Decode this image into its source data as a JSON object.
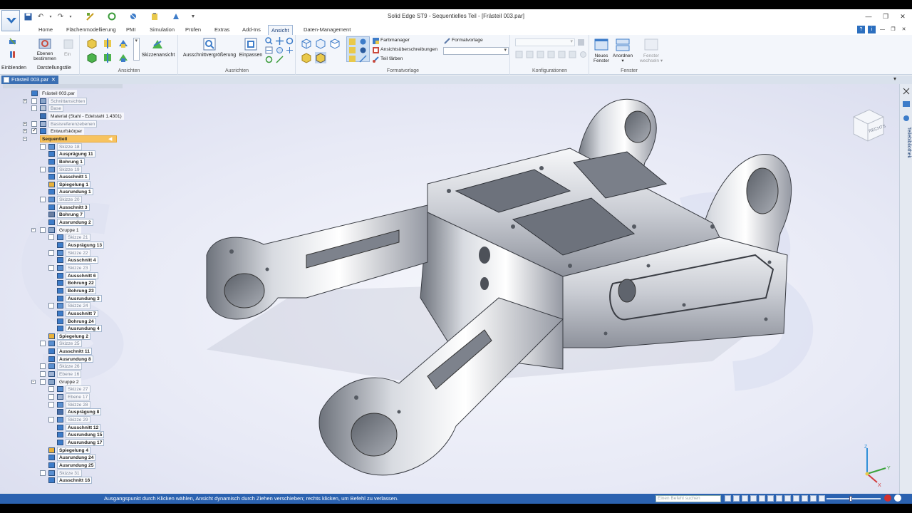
{
  "window": {
    "title": "Solid Edge ST9 - Sequentielles Teil - [Frästeil 003.par]"
  },
  "tabs": [
    "Home",
    "Flächenmodellierung",
    "PMI",
    "Simulation",
    "Prüfen",
    "Extras",
    "Add-Ins",
    "Ansicht",
    "Daten-Management"
  ],
  "active_tab": "Ansicht",
  "ribbon": {
    "einblenden": "Einblenden",
    "ebenen_bestimmen_1": "Ebenen",
    "ebenen_bestimmen_2": "bestimmen",
    "ein": "Ein",
    "darstellungstile": "Darstellungstile",
    "ansichten": "Ansichten",
    "skizzenansicht": "Skizzenansicht",
    "ausschnittvergroesserung": "Ausschnittvergrößerung",
    "einpassen": "Einpassen",
    "ausrichten": "Ausrichten",
    "farbmanager": "Farbmanager",
    "ansichtsueberschreibungen": "Ansichtsüberschreibungen",
    "teil_faerben": "Teil färben",
    "formatvorlage_btn": "Formatvorlage",
    "formatvorlage_group": "Formatvorlage",
    "konfigurationen": "Konfigurationen",
    "neues_fenster_1": "Neues",
    "neues_fenster_2": "Fenster",
    "anordnen": "Anordnen",
    "fenster_wechseln_1": "Fenster",
    "fenster_wechseln_2": "wechseln",
    "fenster_group": "Fenster"
  },
  "document_tab": "Frästeil 003.par",
  "tree": [
    {
      "label": "Frästeil 003.par",
      "indent": 0,
      "style": "plain",
      "exp": "",
      "cb": "",
      "icon": "part"
    },
    {
      "label": "Schnittansichten",
      "indent": 1,
      "style": "dim",
      "exp": "+",
      "cb": "off",
      "icon": "sec"
    },
    {
      "label": "Base",
      "indent": 1,
      "style": "dim",
      "exp": "",
      "cb": "off",
      "icon": "base"
    },
    {
      "label": "Material (Stahl - Edelstahl 1.4301)",
      "indent": 1,
      "style": "plain",
      "exp": "",
      "cb": "",
      "icon": "mat"
    },
    {
      "label": "Basisreferenzebenen",
      "indent": 1,
      "style": "dim",
      "exp": "+",
      "cb": "off",
      "icon": "plane"
    },
    {
      "label": "Entwurfskörper",
      "indent": 1,
      "style": "plain",
      "exp": "+",
      "cb": "on",
      "icon": "body"
    },
    {
      "label": "Sequentiell",
      "indent": 1,
      "style": "sel",
      "exp": "-",
      "cb": "",
      "icon": ""
    },
    {
      "label": "Skizze 18",
      "indent": 2,
      "style": "dim",
      "exp": "",
      "cb": "off",
      "icon": "sketch"
    },
    {
      "label": "Ausprägung 11",
      "indent": 2,
      "style": "bold",
      "exp": "",
      "cb": "",
      "icon": "ext"
    },
    {
      "label": "Bohrung 1",
      "indent": 2,
      "style": "bold",
      "exp": "",
      "cb": "",
      "icon": "hole"
    },
    {
      "label": "Skizze 19",
      "indent": 2,
      "style": "dim",
      "exp": "",
      "cb": "off",
      "icon": "sketch"
    },
    {
      "label": "Ausschnitt 1",
      "indent": 2,
      "style": "bold",
      "exp": "",
      "cb": "",
      "icon": "cut"
    },
    {
      "label": "Spiegelung 1",
      "indent": 2,
      "style": "bold",
      "exp": "",
      "cb": "",
      "icon": "mirror"
    },
    {
      "label": "Ausrundung 1",
      "indent": 2,
      "style": "bold",
      "exp": "",
      "cb": "",
      "icon": "round"
    },
    {
      "label": "Skizze 20",
      "indent": 2,
      "style": "dim",
      "exp": "",
      "cb": "off",
      "icon": "sketch"
    },
    {
      "label": "Ausschnitt 3",
      "indent": 2,
      "style": "bold",
      "exp": "",
      "cb": "",
      "icon": "cut"
    },
    {
      "label": "Bohrung 7",
      "indent": 2,
      "style": "bold",
      "exp": "",
      "cb": "",
      "icon": "hole2"
    },
    {
      "label": "Ausrundung 2",
      "indent": 2,
      "style": "bold",
      "exp": "",
      "cb": "",
      "icon": "round"
    },
    {
      "label": "Gruppe 1",
      "indent": 2,
      "style": "plain",
      "exp": "-",
      "cb": "off",
      "icon": "group"
    },
    {
      "label": "Skizze 21",
      "indent": 3,
      "style": "dim",
      "exp": "",
      "cb": "off",
      "icon": "sketch"
    },
    {
      "label": "Ausprägung 13",
      "indent": 3,
      "style": "bold",
      "exp": "",
      "cb": "",
      "icon": "ext"
    },
    {
      "label": "Skizze 22",
      "indent": 3,
      "style": "dim",
      "exp": "",
      "cb": "off",
      "icon": "sketch"
    },
    {
      "label": "Ausschnitt 4",
      "indent": 3,
      "style": "bold",
      "exp": "",
      "cb": "",
      "icon": "cut"
    },
    {
      "label": "Skizze 23",
      "indent": 3,
      "style": "dim",
      "exp": "",
      "cb": "off",
      "icon": "sketch"
    },
    {
      "label": "Ausschnitt 6",
      "indent": 3,
      "style": "bold",
      "exp": "",
      "cb": "",
      "icon": "cut"
    },
    {
      "label": "Bohrung 22",
      "indent": 3,
      "style": "bold",
      "exp": "",
      "cb": "",
      "icon": "hole"
    },
    {
      "label": "Bohrung 23",
      "indent": 3,
      "style": "bold",
      "exp": "",
      "cb": "",
      "icon": "hole"
    },
    {
      "label": "Ausrundung 3",
      "indent": 3,
      "style": "bold",
      "exp": "",
      "cb": "",
      "icon": "round"
    },
    {
      "label": "Skizze 24",
      "indent": 3,
      "style": "dim",
      "exp": "",
      "cb": "off",
      "icon": "sketch"
    },
    {
      "label": "Ausschnitt 7",
      "indent": 3,
      "style": "bold",
      "exp": "",
      "cb": "",
      "icon": "cut"
    },
    {
      "label": "Bohrung 24",
      "indent": 3,
      "style": "bold",
      "exp": "",
      "cb": "",
      "icon": "hole"
    },
    {
      "label": "Ausrundung 4",
      "indent": 3,
      "style": "bold",
      "exp": "",
      "cb": "",
      "icon": "round"
    },
    {
      "label": "Spiegelung 2",
      "indent": 2,
      "style": "bold",
      "exp": "",
      "cb": "",
      "icon": "mirror"
    },
    {
      "label": "Skizze 25",
      "indent": 2,
      "style": "dim",
      "exp": "",
      "cb": "off",
      "icon": "sketch"
    },
    {
      "label": "Ausschnitt 11",
      "indent": 2,
      "style": "bold",
      "exp": "",
      "cb": "",
      "icon": "cut"
    },
    {
      "label": "Ausrundung 8",
      "indent": 2,
      "style": "bold",
      "exp": "",
      "cb": "",
      "icon": "round"
    },
    {
      "label": "Skizze 26",
      "indent": 2,
      "style": "dim",
      "exp": "",
      "cb": "off",
      "icon": "sketch"
    },
    {
      "label": "Ebene 16",
      "indent": 2,
      "style": "dim",
      "exp": "",
      "cb": "off",
      "icon": "plane"
    },
    {
      "label": "Gruppe 2",
      "indent": 2,
      "style": "plain",
      "exp": "-",
      "cb": "off",
      "icon": "group"
    },
    {
      "label": "Skizze 27",
      "indent": 3,
      "style": "dim",
      "exp": "",
      "cb": "off",
      "icon": "sketch"
    },
    {
      "label": "Ebene 17",
      "indent": 3,
      "style": "dim",
      "exp": "",
      "cb": "off",
      "icon": "plane"
    },
    {
      "label": "Skizze 28",
      "indent": 3,
      "style": "dim",
      "exp": "",
      "cb": "off",
      "icon": "sketch"
    },
    {
      "label": "Ausprägung 8",
      "indent": 3,
      "style": "bold",
      "exp": "",
      "cb": "",
      "icon": "ext2"
    },
    {
      "label": "Skizze 29",
      "indent": 3,
      "style": "dim",
      "exp": "",
      "cb": "off",
      "icon": "sketch"
    },
    {
      "label": "Ausschnitt 12",
      "indent": 3,
      "style": "bold",
      "exp": "",
      "cb": "",
      "icon": "cut"
    },
    {
      "label": "Ausrundung 15",
      "indent": 3,
      "style": "bold",
      "exp": "",
      "cb": "",
      "icon": "round"
    },
    {
      "label": "Ausrundung 17",
      "indent": 3,
      "style": "bold",
      "exp": "",
      "cb": "",
      "icon": "round"
    },
    {
      "label": "Spiegelung 4",
      "indent": 2,
      "style": "bold",
      "exp": "",
      "cb": "",
      "icon": "mirror"
    },
    {
      "label": "Ausrundung 24",
      "indent": 2,
      "style": "bold",
      "exp": "",
      "cb": "",
      "icon": "round"
    },
    {
      "label": "Ausrundung 25",
      "indent": 2,
      "style": "bold",
      "exp": "",
      "cb": "",
      "icon": "round"
    },
    {
      "label": "Skizze 31",
      "indent": 2,
      "style": "dim",
      "exp": "",
      "cb": "off",
      "icon": "sketch"
    },
    {
      "label": "Ausschnitt 16",
      "indent": 2,
      "style": "bold",
      "exp": "",
      "cb": "",
      "icon": "cut"
    }
  ],
  "viewcube_label": "RECHTS",
  "triad": {
    "x": "X",
    "y": "Y",
    "z": "Z"
  },
  "right_panel_label": "Teilebibliothek",
  "statusbar": {
    "message": "Ausgangspunkt durch Klicken wählen, Ansicht dynamisch durch Ziehen verschieben; rechts klicken, um Befehl zu verlassen.",
    "command_search_placeholder": "Einen Befehl suchen"
  },
  "colors": {
    "accent": "#2b62b0",
    "selected_tree": "#f7c35f",
    "viewport_bg": "#e8eaf6"
  }
}
